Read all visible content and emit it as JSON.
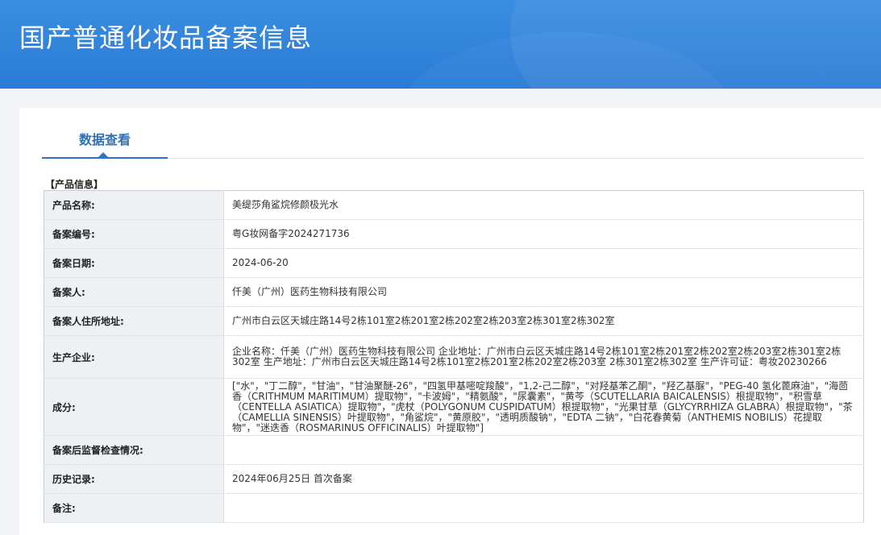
{
  "header": {
    "title": "国产普通化妆品备案信息"
  },
  "tabs": [
    {
      "label": "数据查看",
      "active": true
    }
  ],
  "section": {
    "title": "【产品信息】"
  },
  "rows": [
    {
      "label": "产品名称:",
      "value": "美缇莎角鲨烷修颜极光水"
    },
    {
      "label": "备案编号:",
      "value": "粤G妆网备字2024271736"
    },
    {
      "label": "备案日期:",
      "value": "2024-06-20"
    },
    {
      "label": "备案人:",
      "value": "仟美（广州）医药生物科技有限公司"
    },
    {
      "label": "备案人住所地址:",
      "value": "广州市白云区天城庄路14号2栋101室2栋201室2栋202室2栋203室2栋301室2栋302室"
    },
    {
      "label": "生产企业:",
      "value": "企业名称：仟美（广州）医药生物科技有限公司 企业地址：广州市白云区天城庄路14号2栋101室2栋201室2栋202室2栋203室2栋301室2栋302室 生产地址：广州市白云区天城庄路14号2栋101室2栋201室2栋202室2栋203室 2栋301室2栋302室 生产许可证：粤妆20230266"
    },
    {
      "label": "成分:",
      "value": "[\"水\"，\"丁二醇\"，\"甘油\"，\"甘油聚醚-26\"，\"四氢甲基嘧啶羧酸\"，\"1,2-己二醇\"，\"对羟基苯乙酮\"，\"羟乙基脲\"，\"PEG-40 氢化蓖麻油\"，\"海茴香（CRITHMUM MARITIMUM）提取物\"，\"卡波姆\"，\"精氨酸\"，\"尿囊素\"，\"黄芩（SCUTELLARIA BAICALENSIS）根提取物\"，\"积雪草（CENTELLA ASIATICA）提取物\"，\"虎杖（POLYGONUM CUSPIDATUM）根提取物\"，\"光果甘草（GLYCYRRHIZA GLABRA）根提取物\"，\"茶（CAMELLIA SINENSIS）叶提取物\"，\"角鲨烷\"，\"黄原胶\"，\"透明质酸钠\"，\"EDTA 二钠\"，\"白花春黄菊（ANTHEMIS NOBILIS）花提取物\"，\"迷迭香（ROSMARINUS OFFICINALIS）叶提取物\"]"
    },
    {
      "label": "备案后监督检查情况:",
      "value": ""
    },
    {
      "label": "历史记录:",
      "value": "2024年06月25日 首次备案"
    },
    {
      "label": "备注:",
      "value": ""
    }
  ]
}
